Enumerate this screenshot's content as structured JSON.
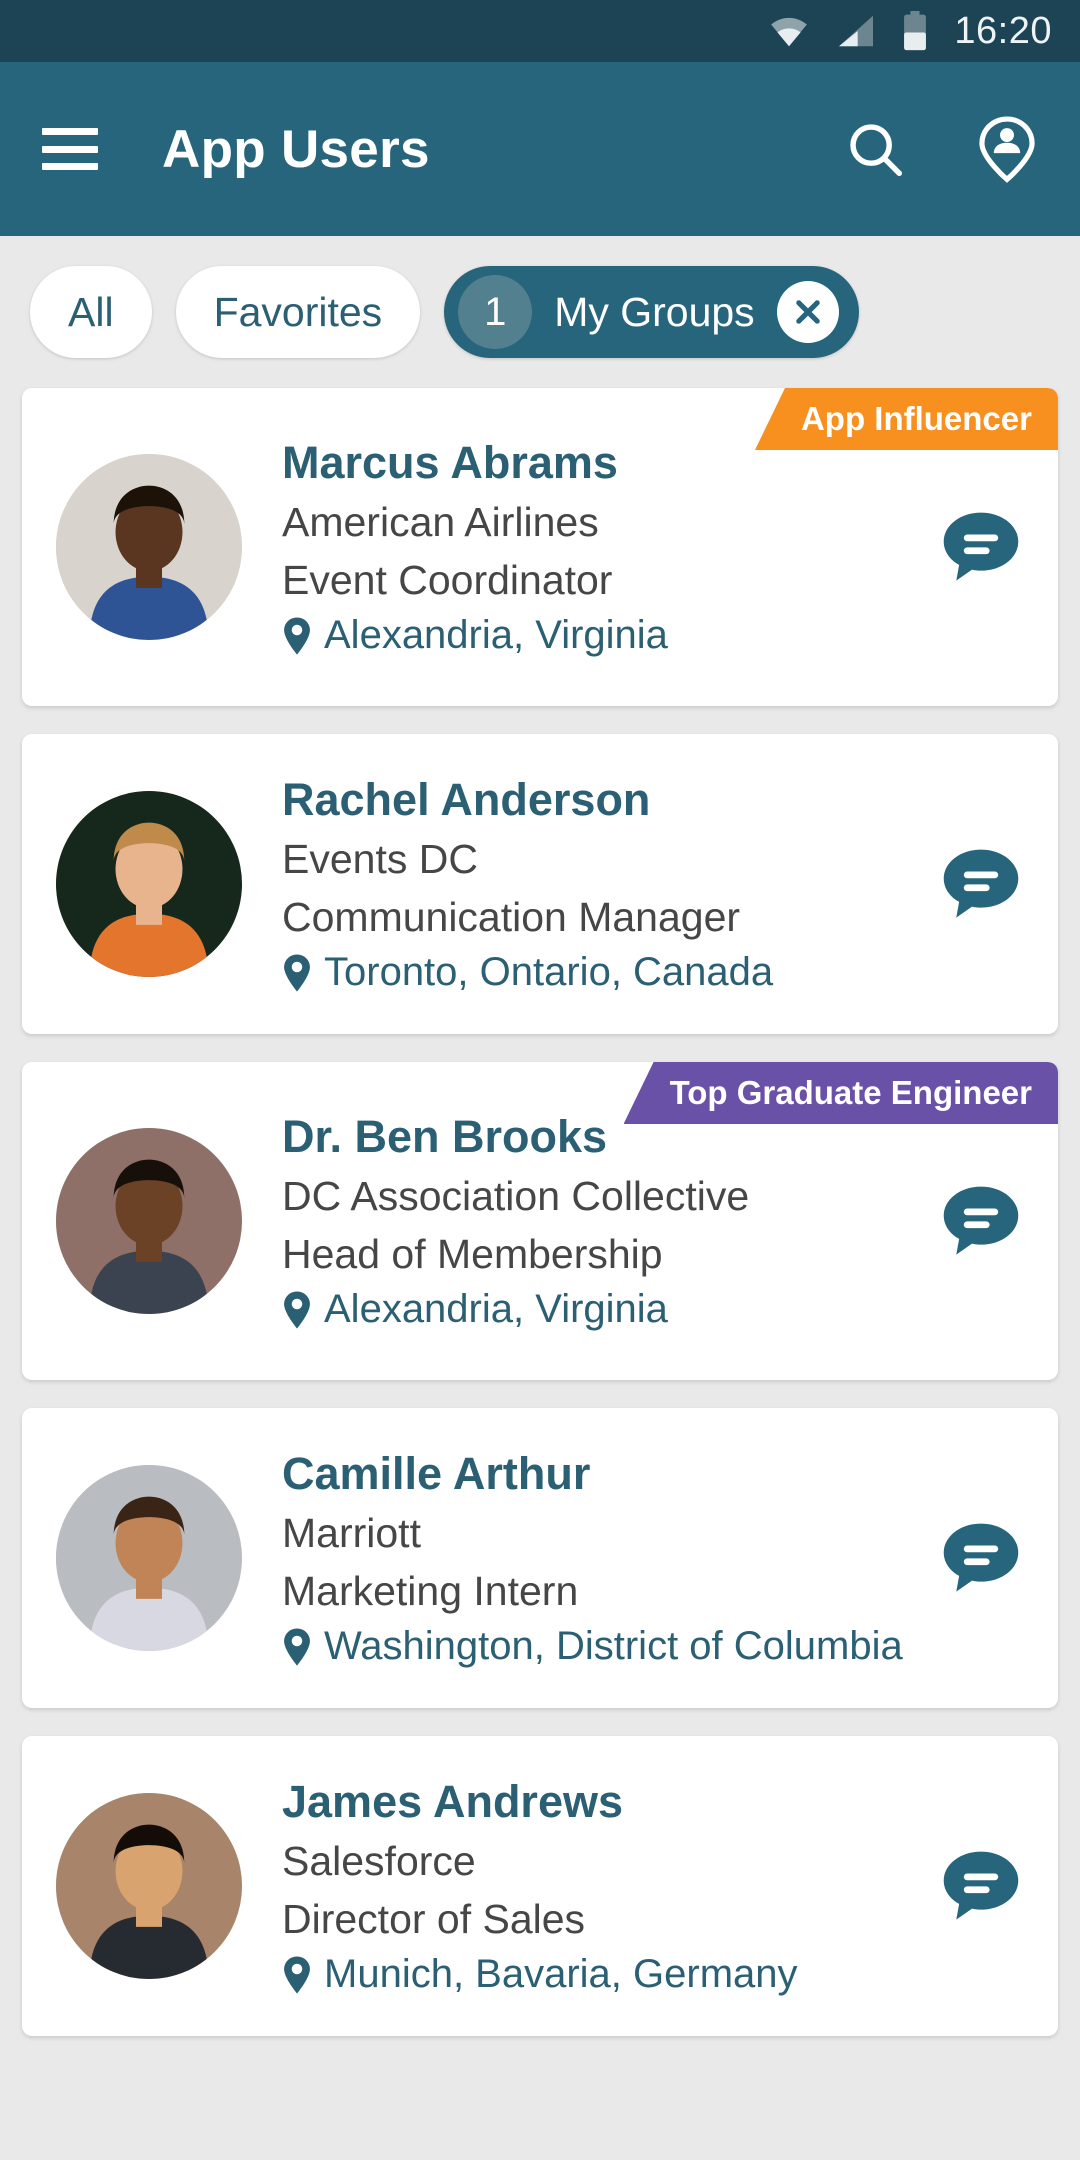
{
  "status_bar": {
    "time": "16:20",
    "icons": [
      "wifi-icon",
      "cellular-signal-icon",
      "battery-icon"
    ],
    "background": "#1d4455"
  },
  "app_bar": {
    "title": "App Users",
    "menu_icon": "hamburger-menu-icon",
    "search_icon": "search-icon",
    "people_locator_icon": "person-pin-icon",
    "background": "#27657c"
  },
  "filters": {
    "chips": [
      {
        "label": "All",
        "selected": false
      },
      {
        "label": "Favorites",
        "selected": false
      },
      {
        "label": "My Groups",
        "selected": true,
        "badge": "1",
        "close_icon": "close-x-icon"
      }
    ]
  },
  "colors": {
    "primary": "#27657c",
    "primary_dark": "#1d4455",
    "accent_teal": "#2b5f73",
    "ribbon_orange": "#f7901e",
    "ribbon_purple": "#6a51a8",
    "page_background": "#e9e9e9"
  },
  "users": [
    {
      "name": "Marcus Abrams",
      "company": "American Airlines",
      "title": "Event Coordinator",
      "location": "Alexandria, Virginia",
      "ribbon": {
        "label": "App Influencer",
        "color": "#f7901e"
      },
      "avatar": {
        "skin": "#5a3520",
        "hair": "#1c1208",
        "clothes": "#2f5496",
        "bg": "#d8d4cd"
      },
      "chat_icon": "chat-bubble-icon"
    },
    {
      "name": "Rachel Anderson",
      "company": "Events DC",
      "title": "Communication Manager",
      "location": "Toronto, Ontario, Canada",
      "ribbon": null,
      "avatar": {
        "skin": "#e8b48e",
        "hair": "#c08a4a",
        "clothes": "#e3762c",
        "bg": "#16281c"
      },
      "chat_icon": "chat-bubble-icon"
    },
    {
      "name": "Dr. Ben Brooks",
      "company": "DC Association Collective",
      "title": "Head of Membership",
      "location": "Alexandria, Virginia",
      "ribbon": {
        "label": "Top Graduate Engineer",
        "color": "#6a51a8"
      },
      "avatar": {
        "skin": "#6b4226",
        "hair": "#17100a",
        "clothes": "#3b4350",
        "bg": "#8f7068"
      },
      "chat_icon": "chat-bubble-icon"
    },
    {
      "name": "Camille Arthur",
      "company": "Marriott",
      "title": "Marketing Intern",
      "location": "Washington, District of Columbia",
      "ribbon": null,
      "avatar": {
        "skin": "#c08457",
        "hair": "#3a2416",
        "clothes": "#d8d8e2",
        "bg": "#b9bcc0"
      },
      "chat_icon": "chat-bubble-icon"
    },
    {
      "name": "James Andrews",
      "company": "Salesforce",
      "title": "Director of Sales",
      "location": "Munich, Bavaria, Germany",
      "ribbon": null,
      "avatar": {
        "skin": "#d9a36f",
        "hair": "#140d07",
        "clothes": "#262a31",
        "bg": "#a8846a"
      },
      "chat_icon": "chat-bubble-icon"
    }
  ]
}
